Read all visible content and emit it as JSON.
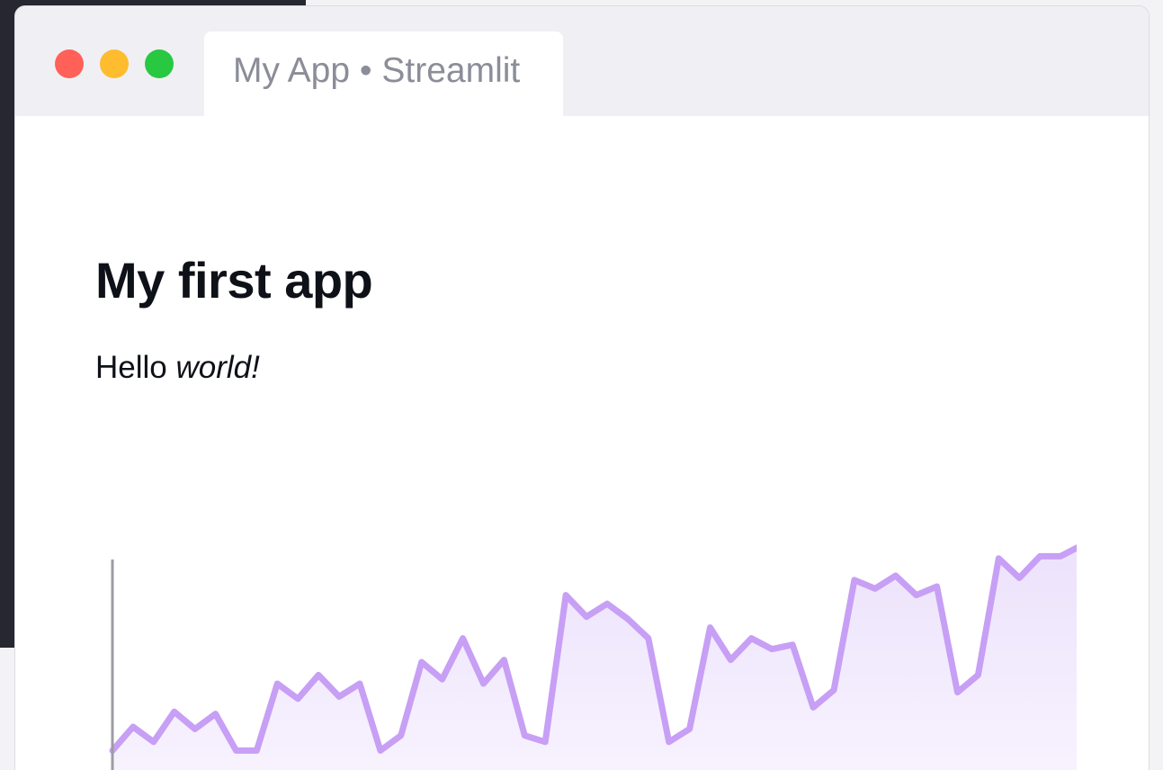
{
  "tab": {
    "title": "My App • Streamlit"
  },
  "window": {
    "traffic_lights": [
      {
        "name": "close",
        "color": "#ff6057"
      },
      {
        "name": "minimize",
        "color": "#febc2e"
      },
      {
        "name": "zoom",
        "color": "#28c840"
      }
    ]
  },
  "main": {
    "title": "My first app",
    "greeting": {
      "plain": "Hello",
      "emphasis": "world!"
    }
  },
  "colors": {
    "line": "#c79ff5",
    "fill_top": "#ece2fc",
    "fill_bottom": "#f8f3fe",
    "axis": "#9c9ca4",
    "text": "#0e1117"
  },
  "chart_data": {
    "type": "area",
    "x": [
      0,
      1,
      2,
      3,
      4,
      5,
      6,
      7,
      8,
      9,
      10,
      11,
      12,
      13,
      14,
      15,
      16,
      17,
      18,
      19,
      20,
      21,
      22,
      23,
      24,
      25,
      26,
      27,
      28,
      29,
      30,
      31,
      32,
      33,
      34,
      35,
      36,
      37,
      38,
      39,
      40,
      41,
      42,
      43,
      44,
      45,
      46,
      47,
      48
    ],
    "values": [
      0.14,
      0.25,
      0.18,
      0.32,
      0.24,
      0.31,
      0.14,
      0.14,
      0.45,
      0.38,
      0.49,
      0.39,
      0.45,
      0.14,
      0.21,
      0.55,
      0.47,
      0.66,
      0.45,
      0.56,
      0.21,
      0.18,
      0.86,
      0.76,
      0.82,
      0.75,
      0.66,
      0.18,
      0.24,
      0.71,
      0.56,
      0.66,
      0.61,
      0.63,
      0.34,
      0.42,
      0.93,
      0.89,
      0.95,
      0.86,
      0.9,
      0.41,
      0.49,
      1.03,
      0.94,
      1.04,
      1.04,
      1.09
    ],
    "ylim": [
      0,
      1.1
    ],
    "xlim": [
      0,
      47
    ],
    "grid": false,
    "legend": "none"
  }
}
